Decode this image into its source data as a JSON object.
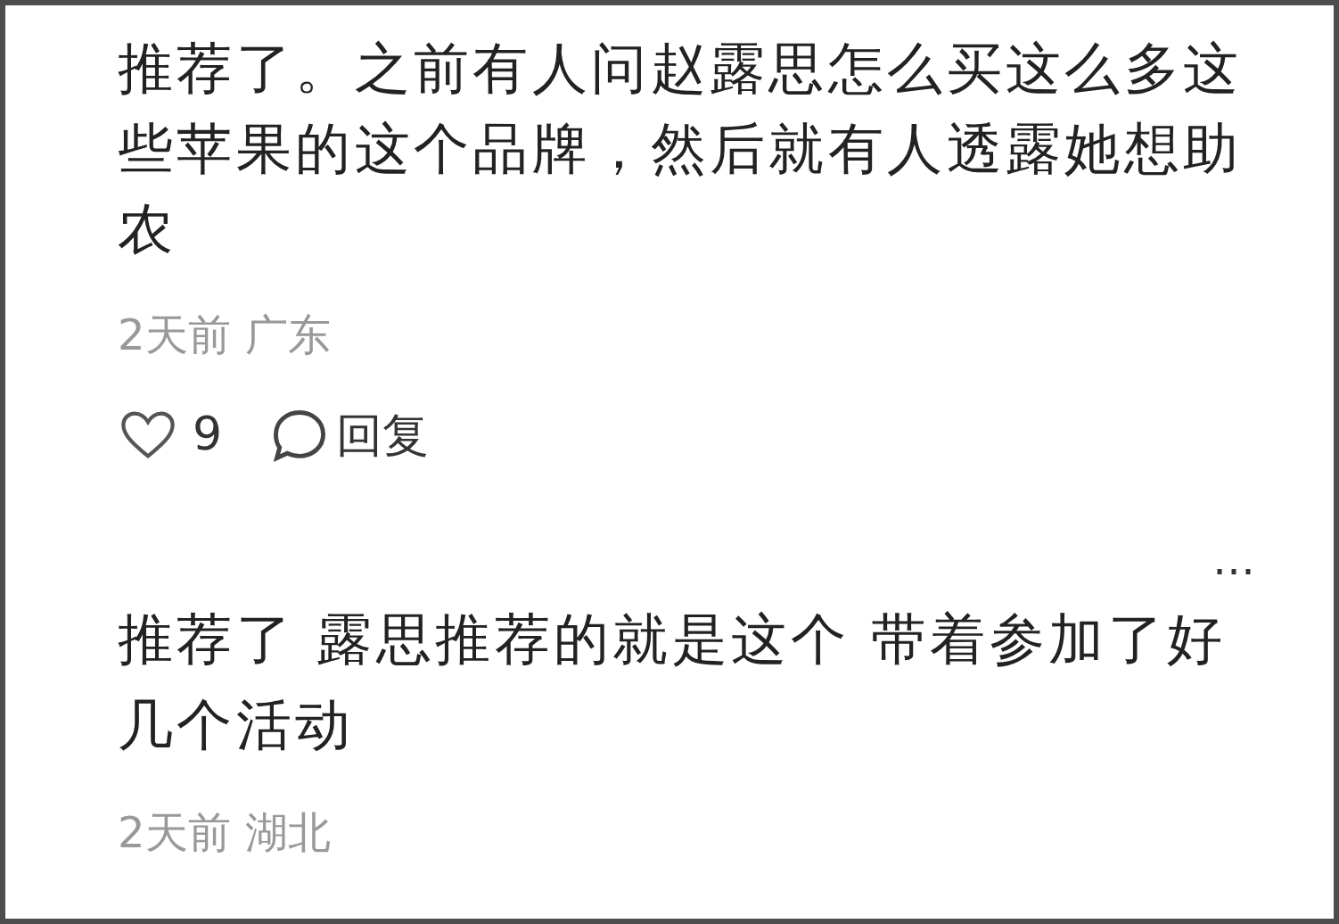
{
  "comments": [
    {
      "lines": [
        "推荐了。之前有人问赵露思怎么买这么多这",
        "些苹果的这个品牌，然后就有人透露她想助",
        "农"
      ],
      "time": "2天前",
      "location": "广东",
      "likes": "9",
      "reply": "回复"
    },
    {
      "more": "…",
      "lines": [
        "推荐了 露思推荐的就是这个 带着参加了好",
        "几个活动"
      ],
      "time": "2天前",
      "location": "湖北"
    }
  ]
}
